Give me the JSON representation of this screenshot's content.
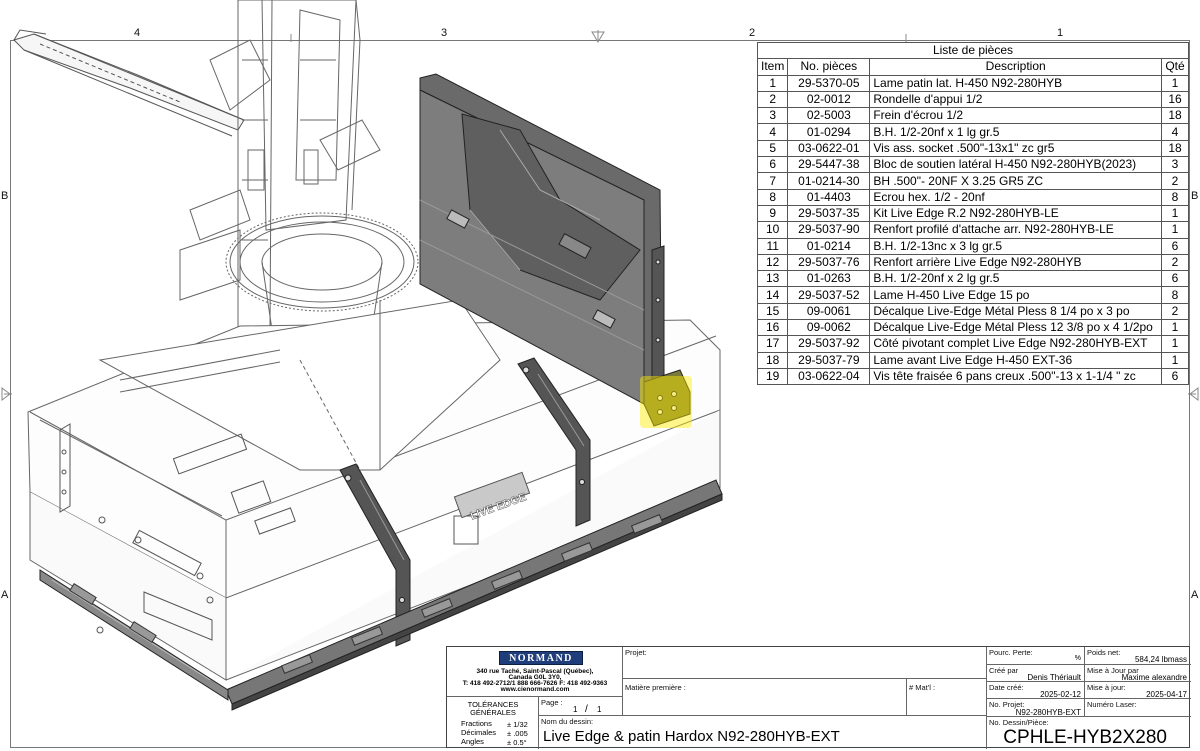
{
  "zones": {
    "top": [
      "4",
      "3",
      "2",
      "1"
    ],
    "left": [
      "B",
      "A"
    ],
    "right": [
      "B",
      "A"
    ]
  },
  "parts_list": {
    "caption": "Liste de pièces",
    "headers": {
      "item": "Item",
      "part_no": "No. pièces",
      "description": "Description",
      "qty": "Qté"
    },
    "rows": [
      {
        "item": "1",
        "part_no": "29-5370-05",
        "description": "Lame patin lat. H-450 N92-280HYB",
        "qty": "1"
      },
      {
        "item": "2",
        "part_no": "02-0012",
        "description": "Rondelle d'appui 1/2",
        "qty": "16"
      },
      {
        "item": "3",
        "part_no": "02-5003",
        "description": "Frein d'écrou 1/2",
        "qty": "18"
      },
      {
        "item": "4",
        "part_no": "01-0294",
        "description": "B.H. 1/2-20nf x 1 lg gr.5",
        "qty": "4"
      },
      {
        "item": "5",
        "part_no": "03-0622-01",
        "description": "Vis ass. socket .500\"-13x1\" zc gr5",
        "qty": "18"
      },
      {
        "item": "6",
        "part_no": "29-5447-38",
        "description": "Bloc de soutien latéral H-450 N92-280HYB(2023)",
        "qty": "3"
      },
      {
        "item": "7",
        "part_no": "01-0214-30",
        "description": "BH .500\"- 20NF X 3.25 GR5 ZC",
        "qty": "2"
      },
      {
        "item": "8",
        "part_no": "01-4403",
        "description": "Ecrou hex. 1/2 - 20nf",
        "qty": "8"
      },
      {
        "item": "9",
        "part_no": "29-5037-35",
        "description": "Kit Live Edge R.2 N92-280HYB-LE",
        "qty": "1"
      },
      {
        "item": "10",
        "part_no": "29-5037-90",
        "description": "Renfort profilé d'attache arr. N92-280HYB-LE",
        "qty": "1"
      },
      {
        "item": "11",
        "part_no": "01-0214",
        "description": "B.H. 1/2-13nc x 3 lg gr.5",
        "qty": "6"
      },
      {
        "item": "12",
        "part_no": "29-5037-76",
        "description": "Renfort arrière Live Edge N92-280HYB",
        "qty": "2"
      },
      {
        "item": "13",
        "part_no": "01-0263",
        "description": "B.H. 1/2-20nf x 2 lg gr.5",
        "qty": "6"
      },
      {
        "item": "14",
        "part_no": "29-5037-52",
        "description": "Lame H-450 Live Edge 15 po",
        "qty": "8"
      },
      {
        "item": "15",
        "part_no": "09-0061",
        "description": "Décalque Live-Edge Métal Pless  8 1/4 po x 3 po",
        "qty": "2"
      },
      {
        "item": "16",
        "part_no": "09-0062",
        "description": "Décalque Live-Edge Métal Pless 12 3/8 po x 4 1/2po",
        "qty": "1"
      },
      {
        "item": "17",
        "part_no": "29-5037-92",
        "description": "Côté pivotant complet Live Edge N92-280HYB-EXT",
        "qty": "1"
      },
      {
        "item": "18",
        "part_no": "29-5037-79",
        "description": "Lame avant Live Edge H-450 EXT-36",
        "qty": "1"
      },
      {
        "item": "19",
        "part_no": "03-0622-04",
        "description": "Vis tête fraisée 6 pans creux .500\"-13 x 1-1/4 \" zc",
        "qty": "6"
      }
    ],
    "highlighted_item": 6,
    "highlight_color": "#ffee00"
  },
  "title_block": {
    "logo": "NORMAND",
    "address_lines": [
      "340 rue Taché, Saint-Pascal (Québec),",
      "Canada  G0L 3Y0,",
      "T: 418 492-2712/1 888 666-7626   F: 418 492-9363",
      "www.cienormand.com"
    ],
    "tolerances_title": "TOLÉRANCES\nGÉNÉRALES",
    "tolerances_title_1": "TOLÉRANCES",
    "tolerances_title_2": "GÉNÉRALES",
    "tolerances": [
      {
        "label": "Fractions",
        "value": "± 1/32"
      },
      {
        "label": "Décimales",
        "value": "± .005"
      },
      {
        "label": "Angles",
        "value": "± 0.5°"
      }
    ],
    "page_label": "Page :",
    "page_current": "1",
    "page_sep": "/",
    "page_total": "1",
    "projet_label": "Projet:",
    "matiere_label": "Matière première :",
    "matl_label": "# Mat'l :",
    "nom_label": "Nom du dessin:",
    "drawing_name": "Live Edge & patin Hardox N92-280HYB-EXT",
    "pourc_perte_label": "Pourc. Perte:",
    "pourc_perte_unit": "%",
    "poids_label": "Poids net:",
    "poids_value": "584,24 lbmass",
    "cree_par_label": "Créé par",
    "cree_par_value": "Denis Thériault",
    "maj_par_label": "Mise à Jour par",
    "maj_par_value": "Maxime alexandre",
    "date_cree_label": "Date créé:",
    "date_cree_value": "2025-02-12",
    "maj_date_label": "Mise à jour:",
    "maj_date_value": "2025-04-17",
    "no_projet_label": "No. Projet:",
    "no_projet_value": "N92-280HYB-EXT",
    "no_laser_label": "Numéro Laser:",
    "no_dessin_label": "No. Dessin/Pièce:",
    "no_dessin_value": "CPHLE-HYB2X280"
  },
  "drawing_labels": {
    "decal_brand": "LIVE EDGE"
  }
}
